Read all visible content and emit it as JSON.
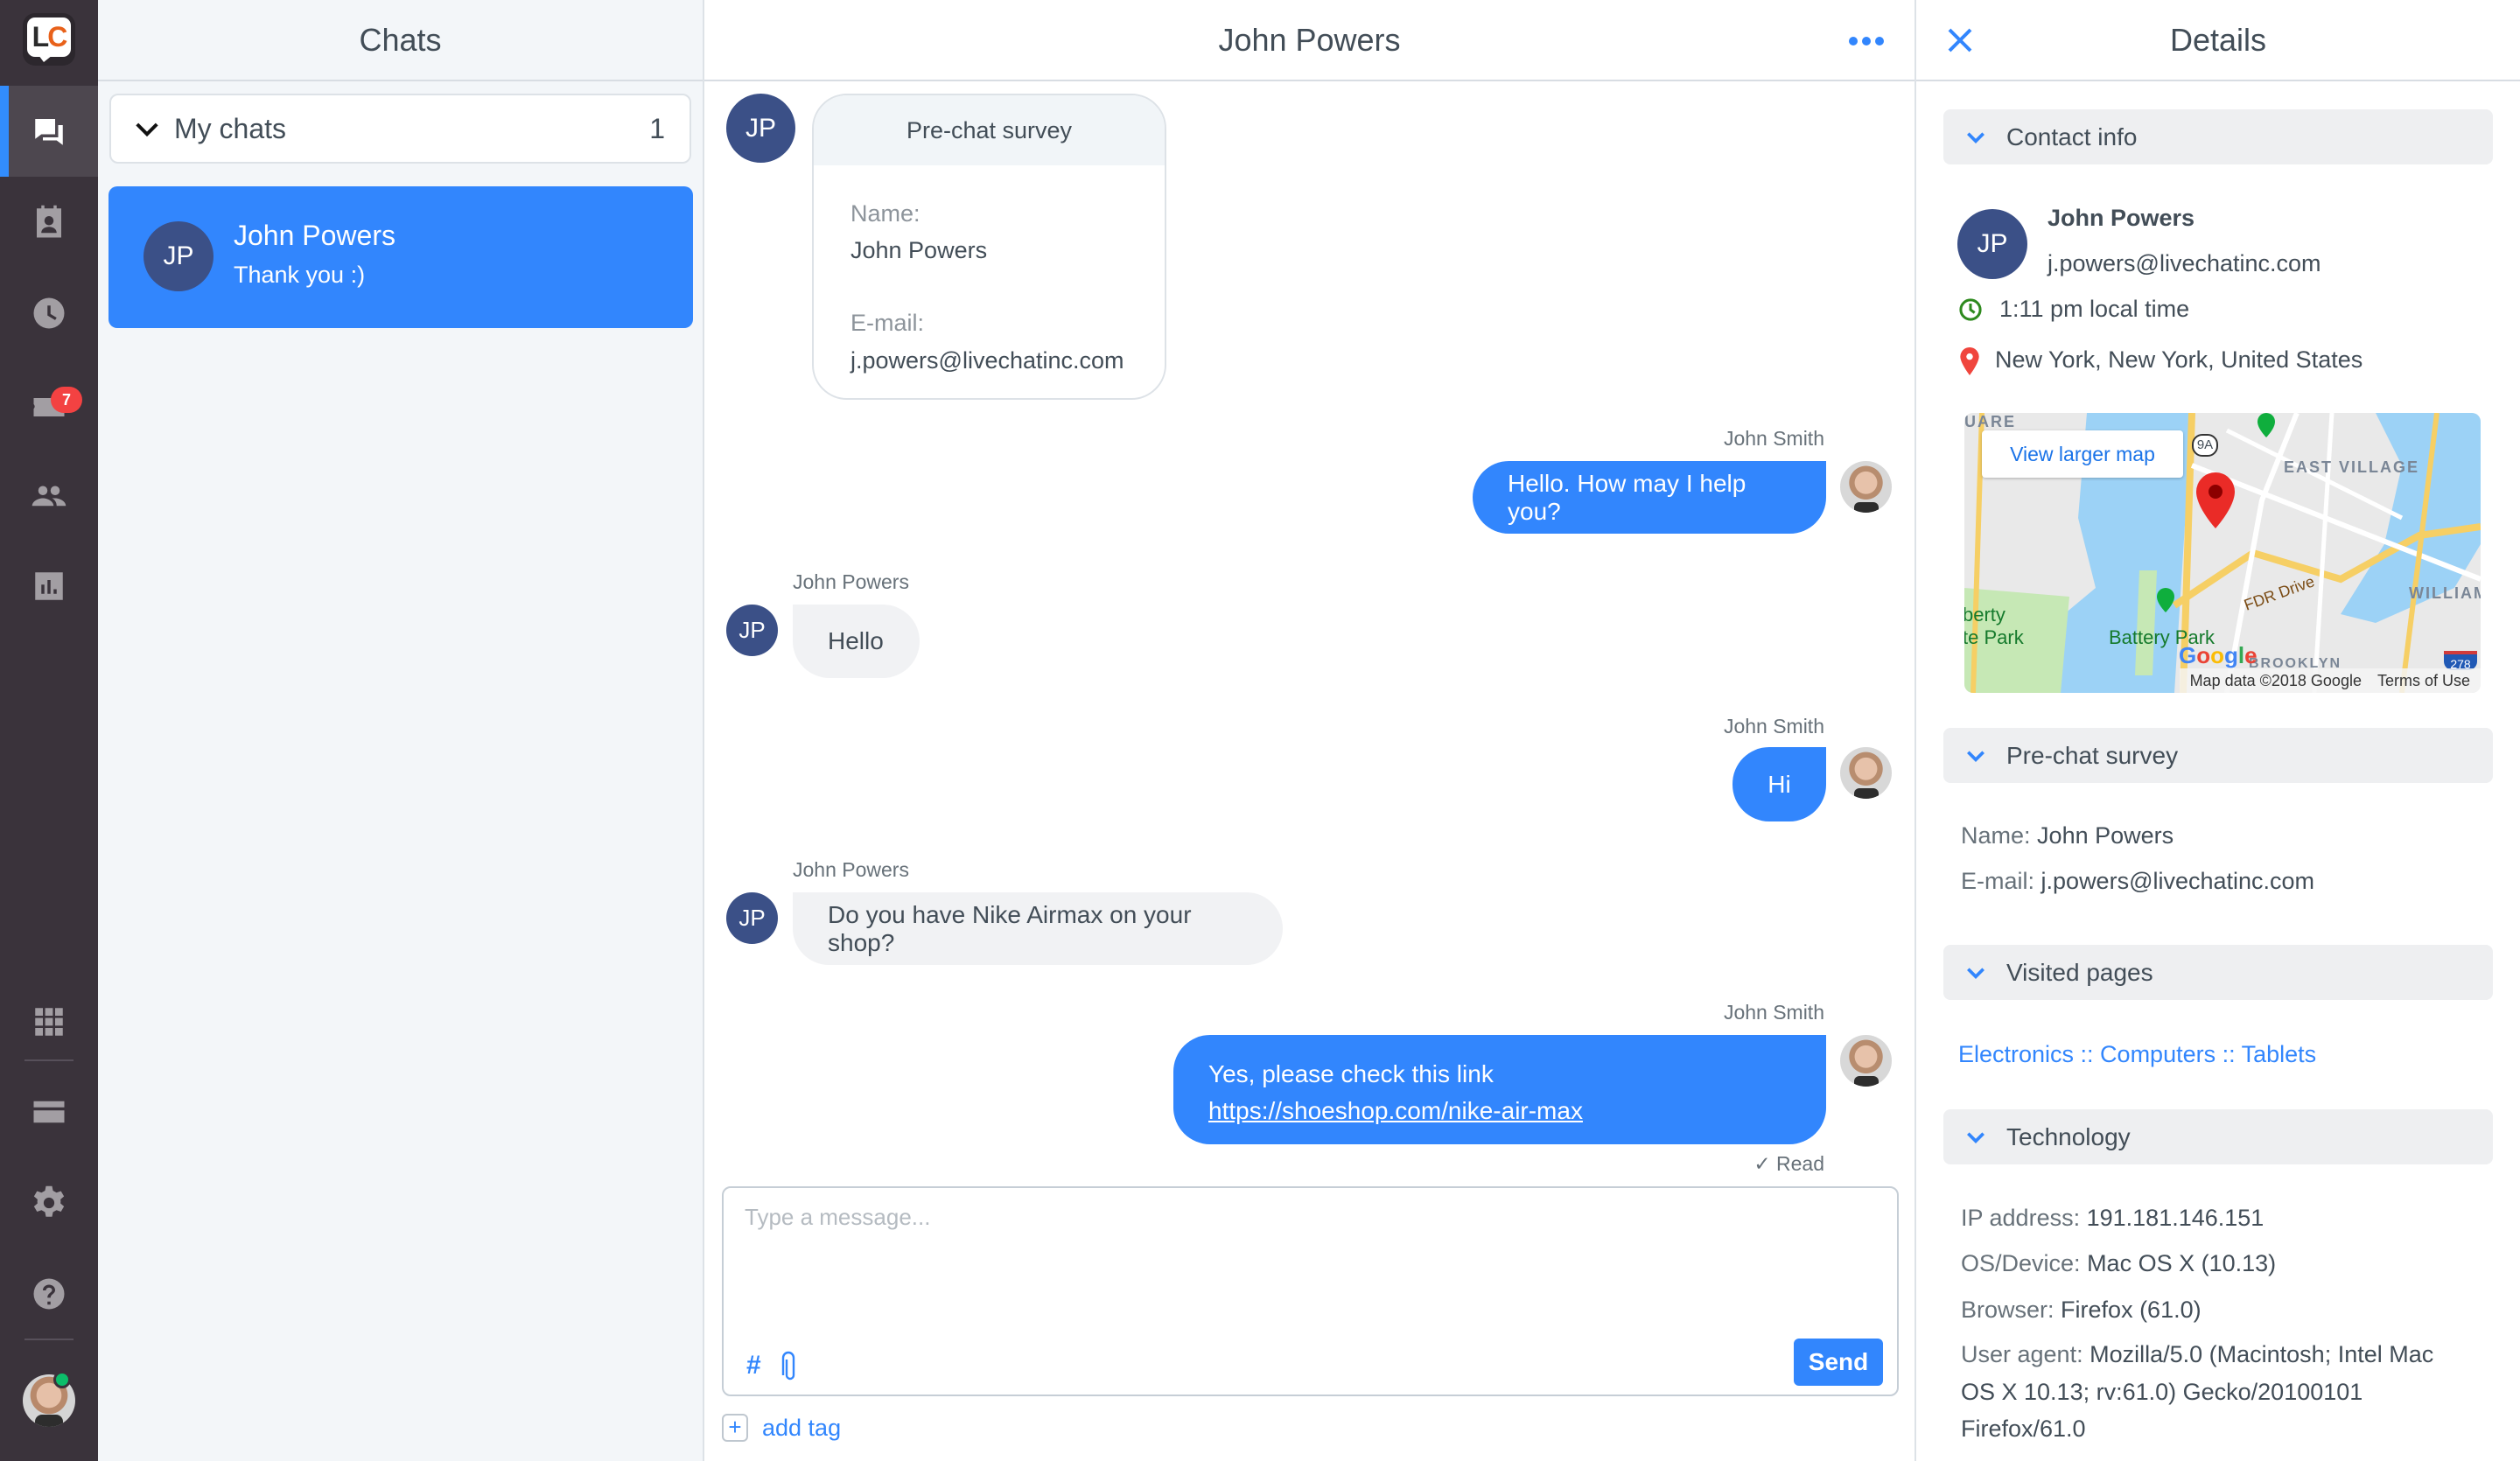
{
  "sidebar": {
    "logo": "LC",
    "items": [
      {
        "name": "chats",
        "icon": "chat-bubbles-icon",
        "active": true
      },
      {
        "name": "customers",
        "icon": "contact-card-icon"
      },
      {
        "name": "archives",
        "icon": "clock-icon"
      },
      {
        "name": "tickets",
        "icon": "ticket-icon",
        "badge": "7"
      },
      {
        "name": "agents",
        "icon": "people-icon"
      },
      {
        "name": "reports",
        "icon": "bar-chart-icon"
      },
      {
        "name": "marketplace",
        "icon": "apps-grid-icon"
      },
      {
        "name": "billing",
        "icon": "credit-card-icon"
      },
      {
        "name": "settings",
        "icon": "gear-icon"
      },
      {
        "name": "help",
        "icon": "help-icon"
      }
    ],
    "user_status": "online"
  },
  "chats_panel": {
    "title": "Chats",
    "group_label": "My chats",
    "group_count": "1",
    "items": [
      {
        "initials": "JP",
        "name": "John Powers",
        "preview": "Thank you :)"
      }
    ]
  },
  "chat": {
    "title": "John Powers",
    "survey": {
      "title": "Pre-chat survey",
      "name_label": "Name:",
      "name_value": "John Powers",
      "email_label": "E-mail:",
      "email_value": "j.powers@livechatinc.com"
    },
    "messages": [
      {
        "sender": "John Smith",
        "role": "agent",
        "text": "Hello. How may I help you?"
      },
      {
        "sender": "John Powers",
        "role": "visitor",
        "text": "Hello"
      },
      {
        "sender": "John Smith",
        "role": "agent",
        "text": "Hi"
      },
      {
        "sender": "John Powers",
        "role": "visitor",
        "text": "Do you have Nike Airmax on your shop?"
      },
      {
        "sender": "John Smith",
        "role": "agent",
        "text": "Yes, please check this link ",
        "link": "https://shoeshop.com/nike-air-max"
      }
    ],
    "visitor_initials": "JP",
    "read_status": "Read",
    "composer": {
      "placeholder": "Type a message...",
      "send_label": "Send",
      "hash_label": "#"
    },
    "add_tag_label": "add tag"
  },
  "details": {
    "title": "Details",
    "contact": {
      "header": "Contact info",
      "initials": "JP",
      "name": "John Powers",
      "email": "j.powers@livechatinc.com",
      "local_time": "1:11 pm local time",
      "location": "New York, New York, United States"
    },
    "map": {
      "button": "View larger map",
      "labels": [
        "EAST VILLAGE",
        "WILLIAM",
        "UARE",
        "BROOKLYN"
      ],
      "green_labels": [
        "berty",
        "te Park",
        "Battery Park"
      ],
      "road": "FDR Drive",
      "shield_9a": "9A",
      "shield_278": "278",
      "google": "Google",
      "attribution": "Map data ©2018 Google",
      "terms": "Terms of Use"
    },
    "prechat": {
      "header": "Pre-chat survey",
      "name_label": "Name:",
      "name_value": "John Powers",
      "email_label": "E-mail:",
      "email_value": "j.powers@livechatinc.com"
    },
    "visited": {
      "header": "Visited pages",
      "link": "Electronics :: Computers :: Tablets"
    },
    "technology": {
      "header": "Technology",
      "ip_label": "IP address:",
      "ip_value": "191.181.146.151",
      "os_label": "OS/Device:",
      "os_value": "Mac OS X (10.13)",
      "browser_label": "Browser:",
      "browser_value": "Firefox (61.0)",
      "ua_label": "User agent:",
      "ua_line1": "Mozilla/5.0 (Macintosh; Intel Mac",
      "ua_line2": "OS X 10.13; rv:61.0) Gecko/20100101",
      "ua_line3": "Firefox/61.0"
    }
  },
  "colors": {
    "accent": "#3286fd",
    "sidebar": "#3a333b",
    "avatar": "#3b5087",
    "badge": "#f34242",
    "online": "#0cbe6a"
  }
}
